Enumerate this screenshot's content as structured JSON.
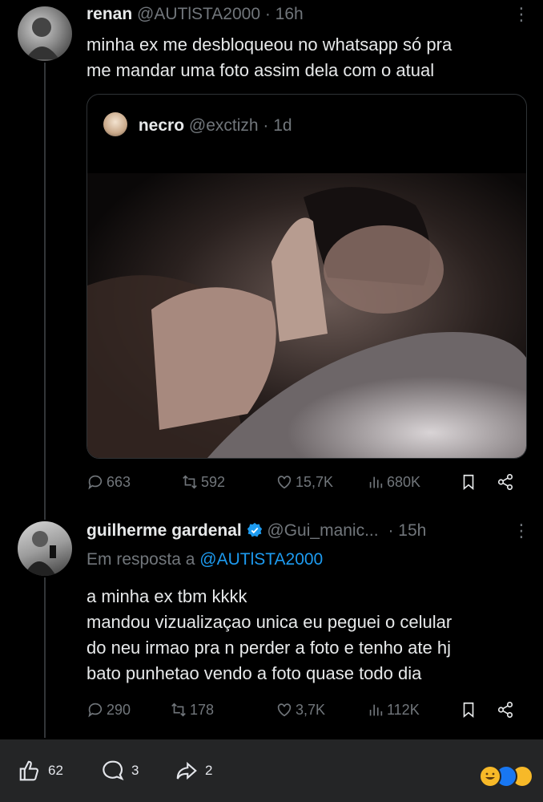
{
  "tweet1": {
    "name": "renan",
    "handle": "@AUTlSTA2000",
    "time": "· 16h",
    "text_line1": "minha ex me desbloqueou no whatsapp só pra",
    "text_line2": "me mandar uma foto assim dela com o atual",
    "quote": {
      "name": "necro",
      "handle": "@exctizh",
      "time": "· 1d"
    },
    "stats": {
      "replies": "663",
      "retweets": "592",
      "likes": "15,7K",
      "views": "680K"
    }
  },
  "tweet2": {
    "name": "guilherme gardenal",
    "handle": "@Gui_manic...",
    "time": "· 15h",
    "reply_prefix": "Em resposta a",
    "reply_to": "@AUTlSTA2000",
    "lines": [
      "a minha ex tbm kkkk",
      "mandou vizualizaçao unica eu peguei o celular",
      "do neu irmao pra n perder a foto e tenho ate hj",
      "bato punhetao vendo a foto quase todo dia"
    ],
    "stats": {
      "replies": "290",
      "retweets": "178",
      "likes": "3,7K",
      "views": "112K"
    }
  },
  "bottom_bar": {
    "likes": "62",
    "comments": "3",
    "shares": "2"
  },
  "colors": {
    "background": "#000000",
    "muted": "#71767b",
    "link": "#1d9bf0",
    "bar": "#242526"
  }
}
